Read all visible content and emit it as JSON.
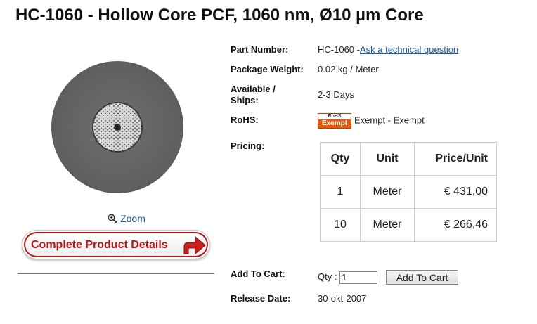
{
  "product": {
    "title": "HC-1060 - Hollow Core PCF, 1060 nm, Ø10 µm Core"
  },
  "left_panel": {
    "zoom_label": "Zoom",
    "details_button_label": "Complete Product Details"
  },
  "info": {
    "part_number_label": "Part Number:",
    "part_number": "HC-1060 -",
    "ask_question_link": "Ask a technical question",
    "package_weight_label": "Package Weight:",
    "package_weight": "0.02 kg / Meter",
    "available_label_line1": "Available /",
    "available_label_line2": "Ships:",
    "available": "2-3 Days",
    "rohs_label": "RoHS:",
    "rohs_badge_top": "RoHS",
    "rohs_badge_bottom": "Exempt",
    "rohs_value": "Exempt - Exempt",
    "pricing_label": "Pricing:",
    "add_to_cart_label": "Add To Cart:",
    "qty_label": "Qty :",
    "qty_value": "1",
    "add_to_cart_button": "Add To Cart",
    "release_date_label": "Release Date:",
    "release_date": "30-okt-2007"
  },
  "pricing_table": {
    "headers": [
      "Qty",
      "Unit",
      "Price/Unit"
    ],
    "rows": [
      [
        "1",
        "Meter",
        "€ 431,00"
      ],
      [
        "10",
        "Meter",
        "€ 266,46"
      ]
    ]
  }
}
